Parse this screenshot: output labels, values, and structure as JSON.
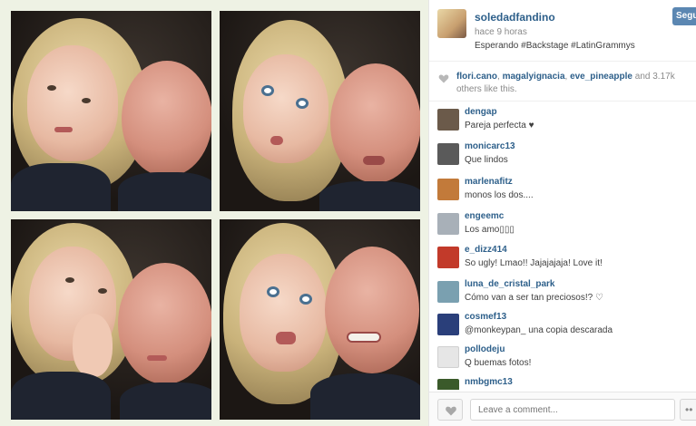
{
  "post": {
    "username": "soledadfandino",
    "time": "hace 9 horas",
    "caption": "Esperando #Backstage #LatinGrammys",
    "follow_label": "Segu"
  },
  "likes": {
    "names": [
      "flori.cano",
      "magalyignacia",
      "eve_pineapple"
    ],
    "separator": ",",
    "tail": " and 3.17k others like this.",
    "count": "3.17k",
    "heart_icon": "heart-icon"
  },
  "comments": [
    {
      "user": "dengap",
      "text": "Pareja perfecta ♥",
      "color": "#6b5a4a"
    },
    {
      "user": "monicarc13",
      "text": "Que lindos",
      "color": "#5a5a5a"
    },
    {
      "user": "marlenafitz",
      "text": "monos los dos....",
      "color": "#c27a3a"
    },
    {
      "user": "engeemc",
      "text": "Los amo▯▯▯",
      "color": "#a8b0b8"
    },
    {
      "user": "e_dizz414",
      "text": "So ugly! Lmao!! Jajajajaja! Love it!",
      "color": "#c23a2a"
    },
    {
      "user": "luna_de_cristal_park",
      "text": "Cómo van a ser tan preciosos!? ♡",
      "color": "#7aa0b0"
    },
    {
      "user": "cosmef13",
      "text": "@monkeypan_ una copia descarada",
      "color": "#2a3f7a"
    },
    {
      "user": "pollodeju",
      "text": "Q buemas fotos!",
      "color": "#e6e6e6"
    },
    {
      "user": "nmbgmc13",
      "text": "",
      "color": "#3a5a2a"
    }
  ],
  "footer": {
    "comment_placeholder": "Leave a comment...",
    "more_label": "••"
  },
  "colors": {
    "link": "#2d5f8a",
    "follow": "#5b87b2"
  }
}
